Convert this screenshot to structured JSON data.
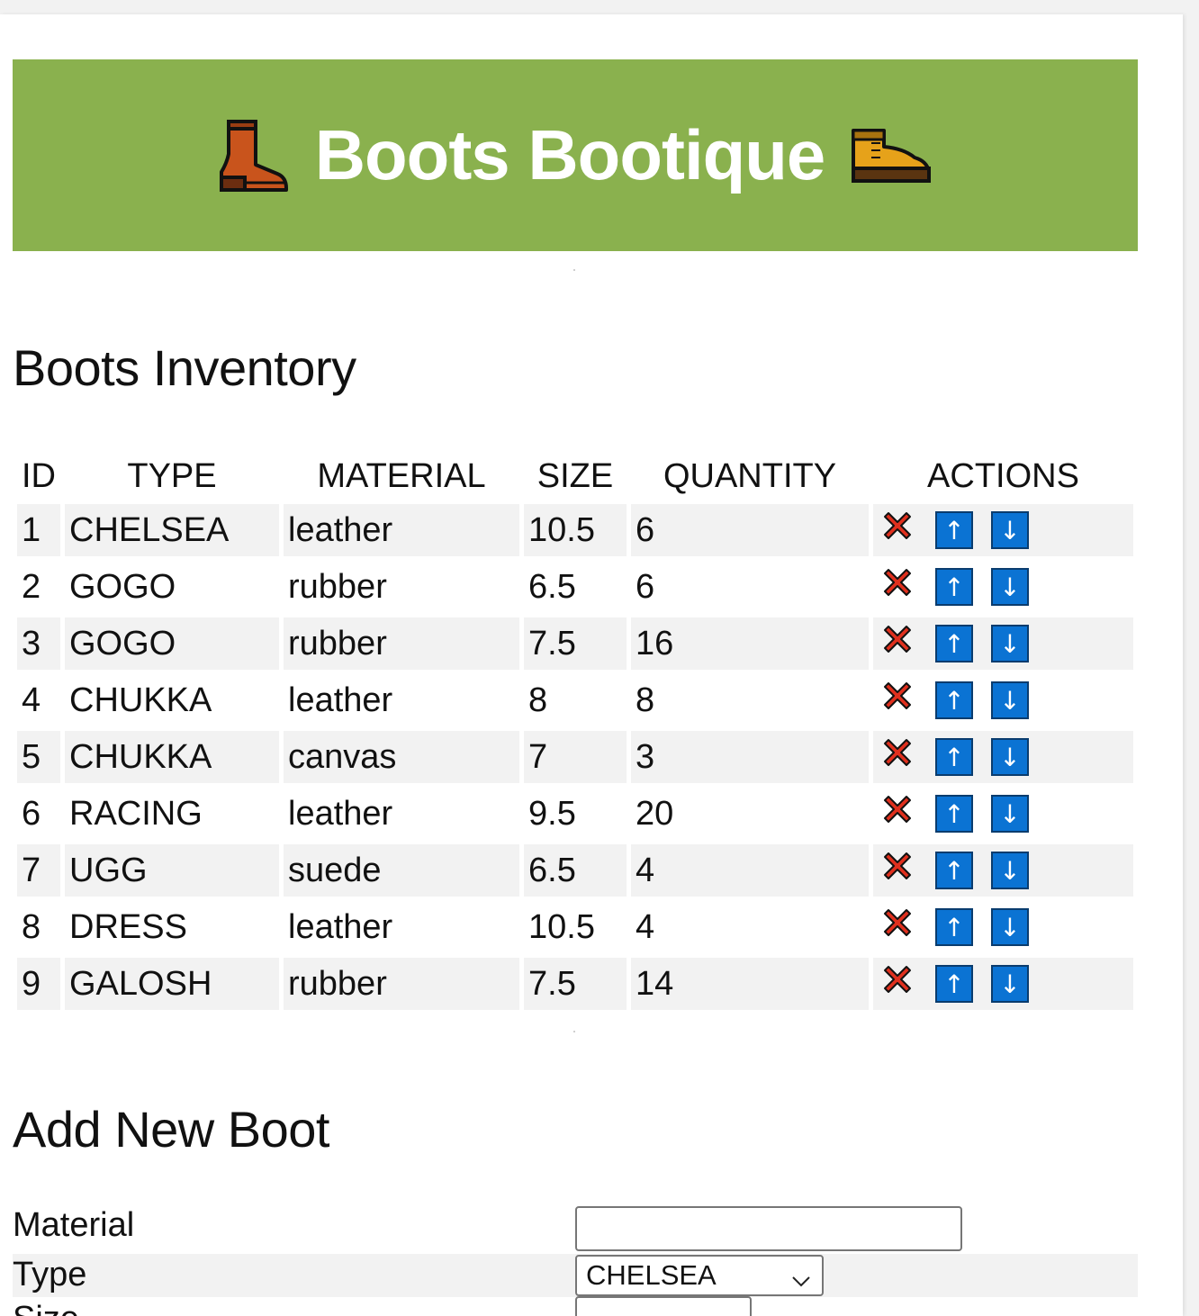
{
  "header": {
    "title": "Boots Bootique",
    "left_icon": "boot-icon",
    "right_icon": "hiking-boot-icon",
    "background_color": "#8ab14e"
  },
  "inventory": {
    "heading": "Boots Inventory",
    "columns": [
      "ID",
      "TYPE",
      "MATERIAL",
      "SIZE",
      "QUANTITY",
      "ACTIONS"
    ],
    "rows": [
      {
        "id": "1",
        "type": "CHELSEA",
        "material": "leather",
        "size": "10.5",
        "quantity": "6"
      },
      {
        "id": "2",
        "type": "GOGO",
        "material": "rubber",
        "size": "6.5",
        "quantity": "6"
      },
      {
        "id": "3",
        "type": "GOGO",
        "material": "rubber",
        "size": "7.5",
        "quantity": "16"
      },
      {
        "id": "4",
        "type": "CHUKKA",
        "material": "leather",
        "size": "8",
        "quantity": "8"
      },
      {
        "id": "5",
        "type": "CHUKKA",
        "material": "canvas",
        "size": "7",
        "quantity": "3"
      },
      {
        "id": "6",
        "type": "RACING",
        "material": "leather",
        "size": "9.5",
        "quantity": "20"
      },
      {
        "id": "7",
        "type": "UGG",
        "material": "suede",
        "size": "6.5",
        "quantity": "4"
      },
      {
        "id": "8",
        "type": "DRESS",
        "material": "leather",
        "size": "10.5",
        "quantity": "4"
      },
      {
        "id": "9",
        "type": "GALOSH",
        "material": "rubber",
        "size": "7.5",
        "quantity": "14"
      }
    ],
    "actions": {
      "delete_icon": "cross-mark-icon",
      "up_icon": "arrow-up-icon",
      "up_glyph": "↑",
      "down_icon": "arrow-down-icon",
      "down_glyph": "↓",
      "button_color": "#0b73d3",
      "delete_color": "#e0301e"
    }
  },
  "add_form": {
    "heading": "Add New Boot",
    "material_label": "Material",
    "material_value": "",
    "type_label": "Type",
    "type_selected": "CHELSEA",
    "size_label": "Size",
    "size_value": ""
  }
}
